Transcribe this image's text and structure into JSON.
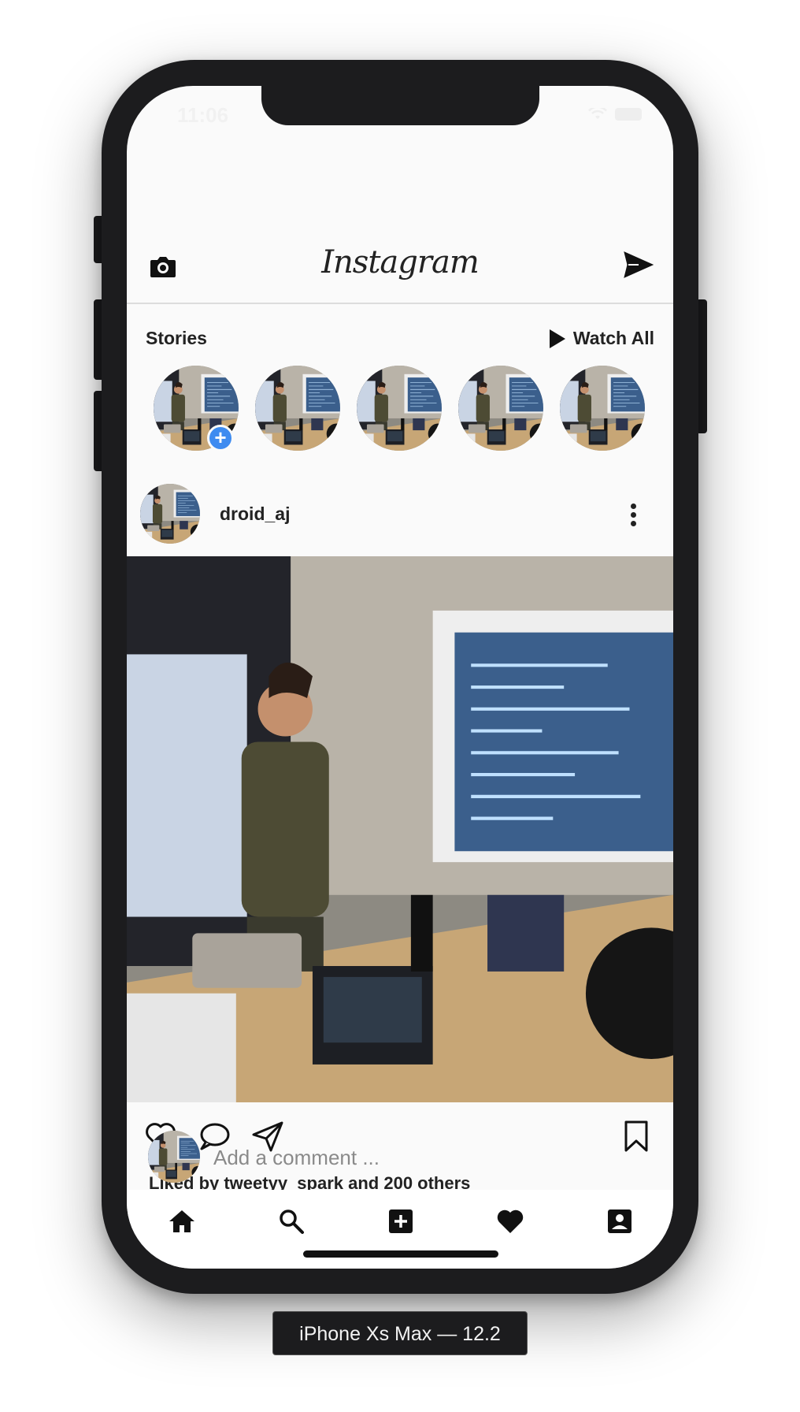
{
  "status_bar": {
    "time": "11:06"
  },
  "topbar": {
    "title": "Instagram"
  },
  "stories": {
    "title": "Stories",
    "watch_all": "Watch All",
    "add_symbol": "+"
  },
  "post": {
    "username": "droid_aj",
    "likes_text": "Liked by tweetyy_spark and 200 others",
    "comment_placeholder": "Add a comment ..."
  },
  "device": {
    "label": "iPhone Xs Max — 12.2"
  },
  "icons": {
    "camera": "camera-icon",
    "send": "send-icon",
    "like": "heart-outline-icon",
    "comment": "comment-bubble-icon",
    "share": "paper-plane-icon",
    "save": "bookmark-icon",
    "home": "home-icon",
    "search": "search-icon",
    "add": "add-box-icon",
    "activity": "heart-filled-icon",
    "profile": "profile-box-icon"
  },
  "colors": {
    "accent": "#3e8bf0",
    "text": "#222222",
    "background": "#fafafa"
  }
}
